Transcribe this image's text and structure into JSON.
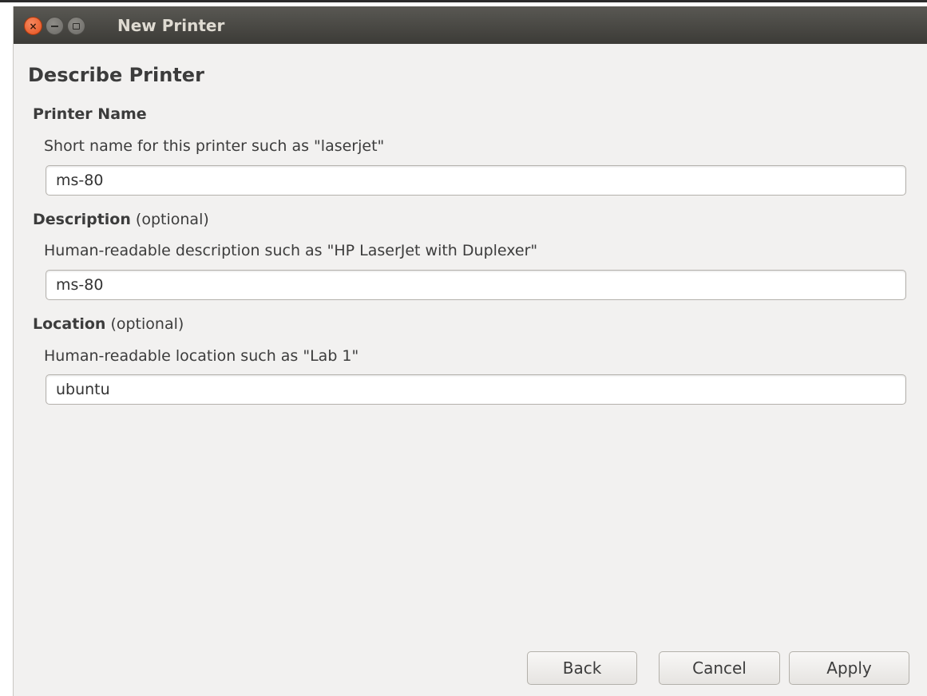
{
  "window": {
    "title": "New Printer"
  },
  "page": {
    "heading": "Describe Printer"
  },
  "printer_name": {
    "label": "Printer Name",
    "hint": "Short name for this printer such as \"laserjet\"",
    "value": "ms-80"
  },
  "description": {
    "label": "Description",
    "label_suffix": " (optional)",
    "hint": "Human-readable description such as \"HP LaserJet with Duplexer\"",
    "value": "ms-80"
  },
  "location": {
    "label": "Location",
    "label_suffix": " (optional)",
    "hint": "Human-readable location such as \"Lab 1\"",
    "value": "ubuntu"
  },
  "buttons": {
    "back": "Back",
    "cancel": "Cancel",
    "apply": "Apply"
  },
  "icons": {
    "close": "close-icon",
    "minimize": "minimize-icon",
    "maximize": "maximize-icon"
  },
  "colors": {
    "titlebar": "#3c3b37",
    "close_button": "#e5501d",
    "window_background": "#f2f1f0"
  }
}
